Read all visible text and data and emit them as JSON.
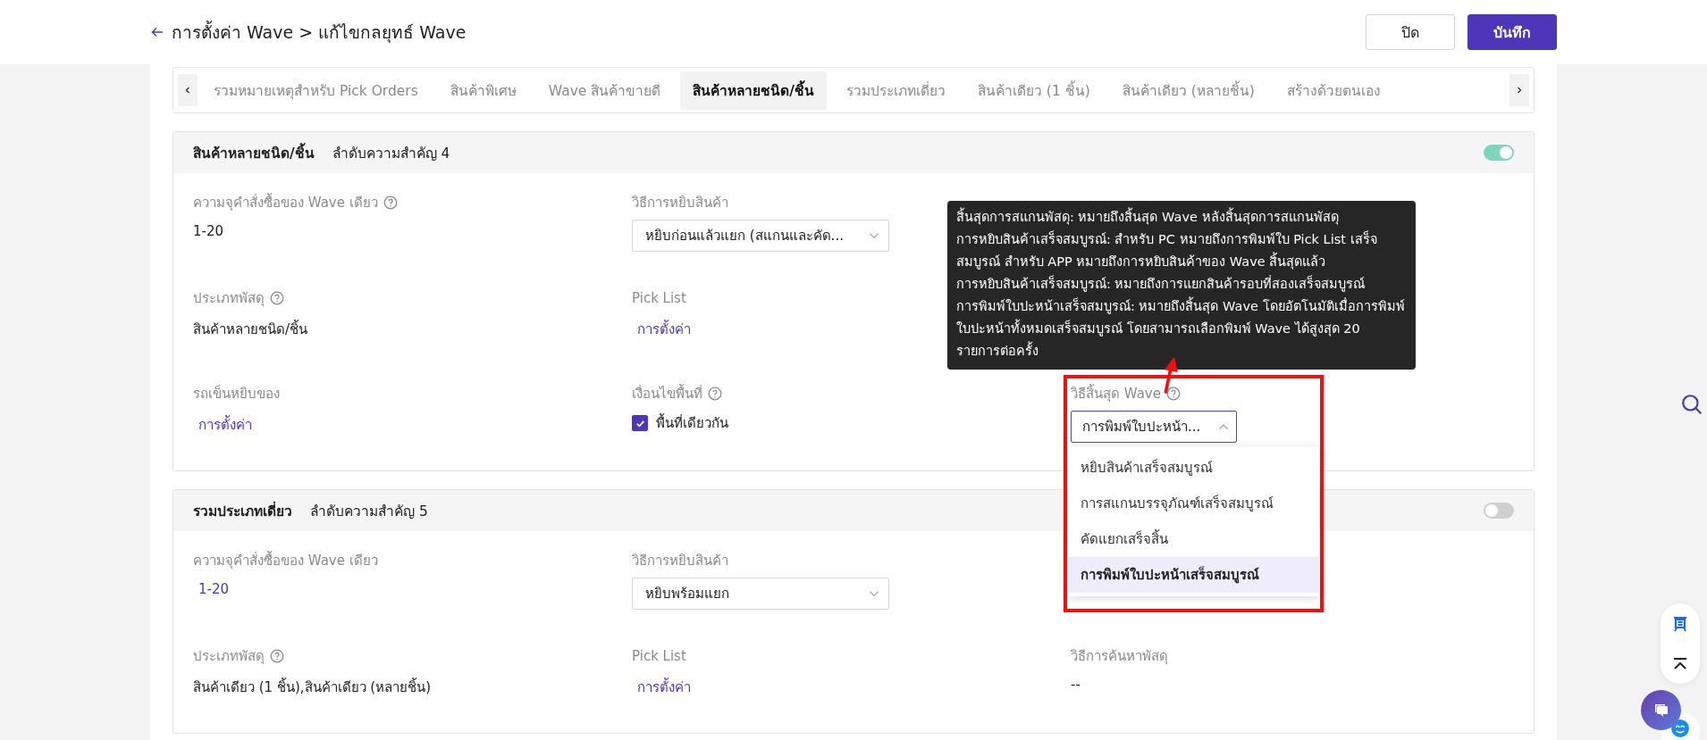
{
  "header": {
    "breadcrumb": "การตั้งค่า Wave > แก้ไขกลยุทธ์ Wave",
    "buttons": [
      {
        "label": "ปิด",
        "kind": "secondary"
      },
      {
        "label": "บันทึก",
        "kind": "primary"
      }
    ]
  },
  "tabs": [
    {
      "label": "รวมหมายเหตุสำหรับ Pick Orders",
      "selected": false
    },
    {
      "label": "สินค้าพิเศษ",
      "selected": false
    },
    {
      "label": "Wave สินค้าขายดี",
      "selected": false
    },
    {
      "label": "สินค้าหลายชนิด/ชิ้น",
      "selected": true
    },
    {
      "label": "รวมประเภทเดี่ยว",
      "selected": false
    },
    {
      "label": "สินค้าเดียว (1 ชิ้น)",
      "selected": false
    },
    {
      "label": "สินค้าเดียว (หลายชิ้น)",
      "selected": false
    },
    {
      "label": "สร้างด้วยตนเอง",
      "selected": false
    }
  ],
  "cards": [
    {
      "title": "สินค้าหลายชนิด/ชิ้น",
      "priority": "ลำดับความสำคัญ 4",
      "enabled": true,
      "columns": [
        [
          {
            "label": "ความจุคำสั่งซื้อของ Wave เดียว",
            "help": true,
            "kind": "text",
            "value": "1-20"
          },
          {
            "label": "ประเภทพัสดุ",
            "help": true,
            "kind": "text",
            "value": "สินค้าหลายชนิด/ชิ้น"
          },
          {
            "label": "รถเข็นหยิบของ",
            "help": false,
            "kind": "link",
            "value": "การตั้งค่า"
          }
        ],
        [
          {
            "label": "วิธีการหยิบสินค้า",
            "help": false,
            "kind": "select",
            "value": "หยิบก่อนแล้วแยก (สแกนและคัด...",
            "open": false
          },
          {
            "label": "Pick List",
            "help": false,
            "kind": "link",
            "value": "การตั้งค่า"
          },
          {
            "label": "เงื่อนไขพื้นที่",
            "help": true,
            "kind": "checkbox",
            "value": "พื้นที่เดียวกัน",
            "checked": true
          }
        ],
        [
          {
            "label": "วิธีสิ้นสุด Wave",
            "help": true,
            "kind": "select",
            "value": "การพิมพ์ใบปะหน้า...",
            "open": true,
            "tooltip": [
              "สิ้นสุดการสแกนพัสดุ: หมายถึงสิ้นสุด Wave หลังสิ้นสุดการสแกนพัสดุ",
              "การหยิบสินค้าเสร็จสมบูรณ์: สำหรับ PC หมายถึงการพิมพ์ใบ Pick List เสร็จสมบูรณ์ สำหรับ APP หมายถึงการหยิบสินค้าของ Wave สิ้นสุดแล้ว",
              "การหยิบสินค้าเสร็จสมบูรณ์: หมายถึงการแยกสินค้ารอบที่สองเสร็จสมบูรณ์",
              "การพิมพ์ใบปะหน้าเสร็จสมบูรณ์: หมายถึงสิ้นสุด Wave โดยอัตโนมัติเมื่อการพิมพ์ใบปะหน้าทั้งหมดเสร็จสมบูรณ์ โดยสามารถเลือกพิมพ์ Wave ได้สูงสุด 20 รายการต่อครั้ง"
            ],
            "options": [
              {
                "label": "หยิบสินค้าเสร็จสมบูรณ์",
                "selected": false
              },
              {
                "label": "การสแกนบรรจุภัณฑ์เสร็จสมบูรณ์",
                "selected": false
              },
              {
                "label": "คัดแยกเสร็จสิ้น",
                "selected": false
              },
              {
                "label": "การพิมพ์ใบปะหน้าเสร็จสมบูรณ์",
                "selected": true
              }
            ]
          }
        ]
      ]
    },
    {
      "title": "รวมประเภทเดี่ยว",
      "priority": "ลำดับความสำคัญ 5",
      "enabled": false,
      "columns": [
        [
          {
            "label": "ความจุคำสั่งซื้อของ Wave เดียว",
            "help": false,
            "kind": "link",
            "value": "1-20"
          },
          {
            "label": "ประเภทพัสดุ",
            "help": true,
            "kind": "text",
            "value": "สินค้าเดียว (1 ชิ้น),สินค้าเดียว (หลายชิ้น)"
          }
        ],
        [
          {
            "label": "วิธีการหยิบสินค้า",
            "help": false,
            "kind": "select",
            "value": "หยิบพร้อมแยก",
            "open": false
          },
          {
            "label": "Pick List",
            "help": false,
            "kind": "link",
            "value": "การตั้งค่า"
          }
        ],
        [
          {
            "label": "วิธีการค้นหาพัสดุ",
            "help": false,
            "kind": "text",
            "value": "--"
          }
        ]
      ]
    }
  ]
}
